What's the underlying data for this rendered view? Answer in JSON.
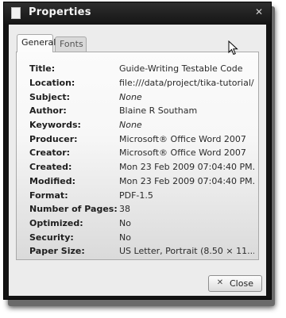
{
  "window": {
    "title": "Properties"
  },
  "tabs": [
    {
      "label": "General",
      "active": true
    },
    {
      "label": "Fonts",
      "active": false
    }
  ],
  "properties": [
    {
      "label": "Title:",
      "value": "Guide-Writing Testable Code",
      "italic": false
    },
    {
      "label": "Location:",
      "value": "file:///data/project/tika-tutorial/...",
      "italic": false
    },
    {
      "label": "Subject:",
      "value": "None",
      "italic": true
    },
    {
      "label": "Author:",
      "value": "Blaine R Southam",
      "italic": false
    },
    {
      "label": "Keywords:",
      "value": "None",
      "italic": true
    },
    {
      "label": "Producer:",
      "value": "Microsoft® Office Word 2007",
      "italic": false
    },
    {
      "label": "Creator:",
      "value": "Microsoft® Office Word 2007",
      "italic": false
    },
    {
      "label": "Created:",
      "value": "Mon 23 Feb 2009 07:04:40 PM...",
      "italic": false
    },
    {
      "label": "Modified:",
      "value": "Mon 23 Feb 2009 07:04:40 PM...",
      "italic": false
    },
    {
      "label": "Format:",
      "value": "PDF-1.5",
      "italic": false
    },
    {
      "label": "Number of Pages:",
      "value": "38",
      "italic": false
    },
    {
      "label": "Optimized:",
      "value": "No",
      "italic": false
    },
    {
      "label": "Security:",
      "value": "No",
      "italic": false
    },
    {
      "label": "Paper Size:",
      "value": "US Letter, Portrait (8.50 × 11....",
      "italic": false
    }
  ],
  "buttons": {
    "close_label": "Close"
  },
  "icons": {
    "app": "document-icon",
    "window_close": "close-icon",
    "button_close": "close-x-icon",
    "cursor": "mouse-pointer-icon"
  },
  "colors": {
    "titlebar": "#1a1a1a",
    "dialog_bg": "#ececec"
  }
}
